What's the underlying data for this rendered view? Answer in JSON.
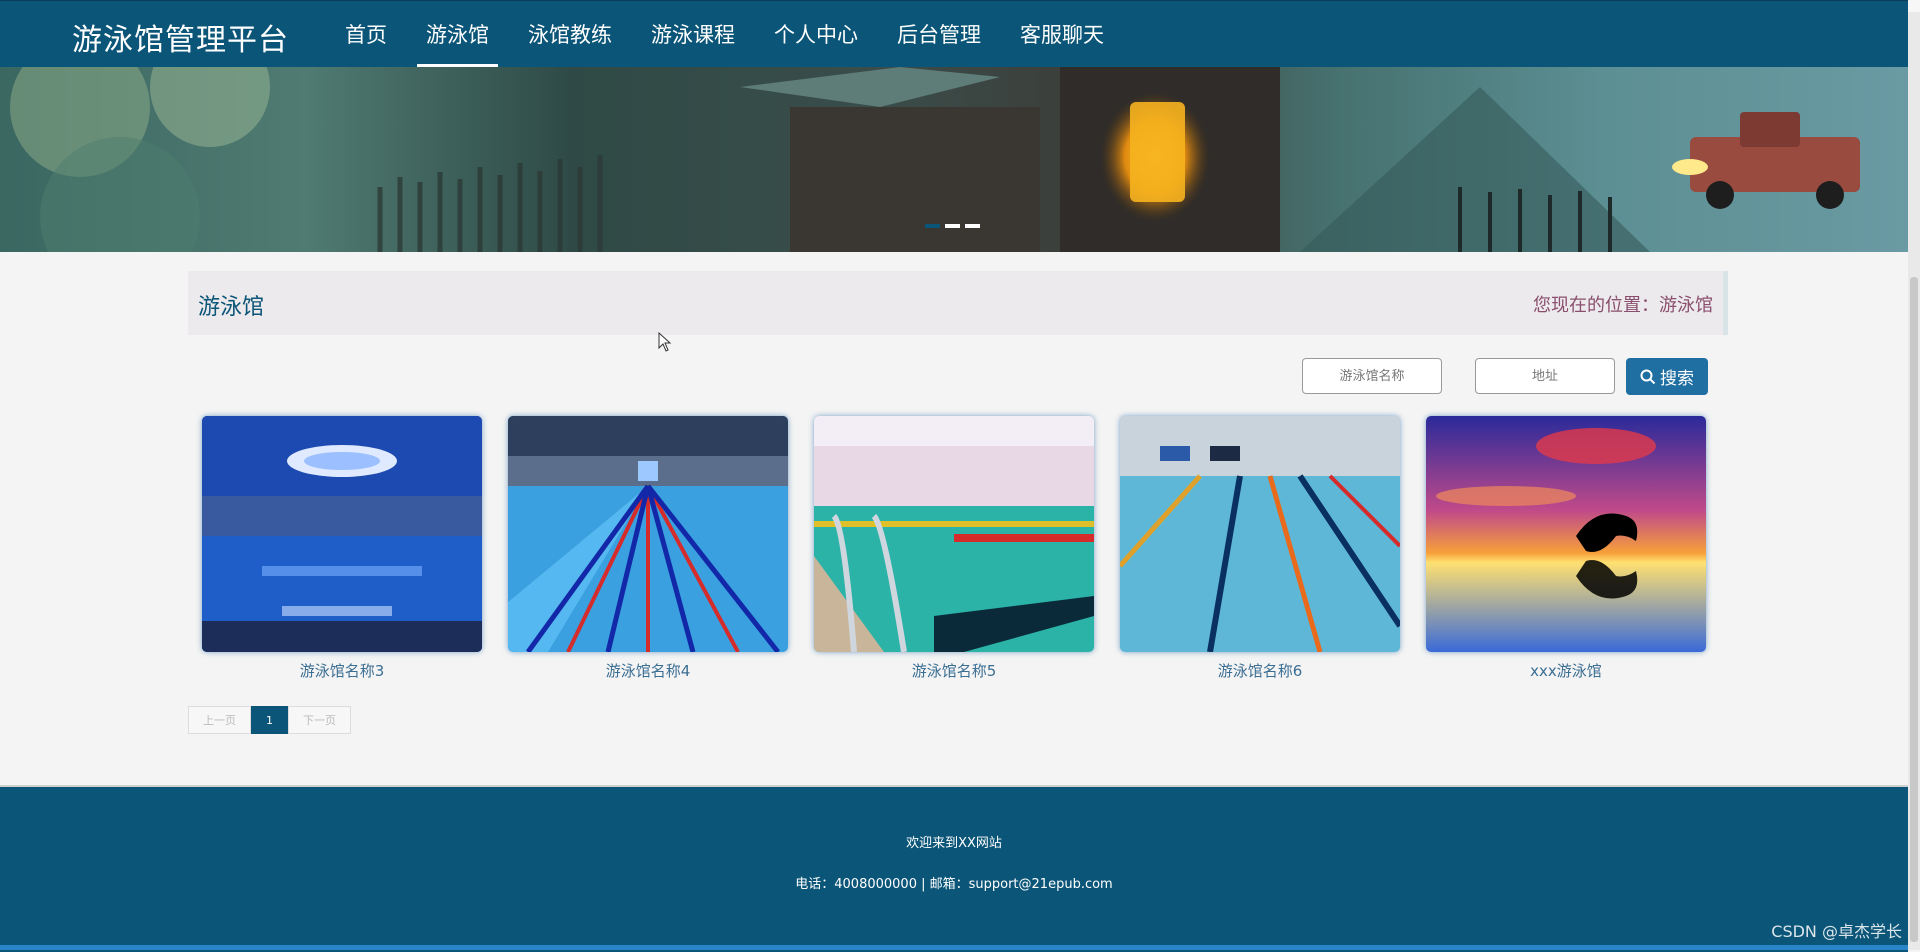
{
  "header": {
    "brand": "游泳馆管理平台",
    "nav": [
      "首页",
      "游泳馆",
      "泳馆教练",
      "游泳课程",
      "个人中心",
      "后台管理",
      "客服聊天"
    ],
    "active_nav": "游泳馆"
  },
  "banner": {
    "slides": 3,
    "active_slide": 1
  },
  "page": {
    "title": "游泳馆",
    "location": "您现在的位置：游泳馆"
  },
  "search": {
    "name_placeholder": "游泳馆名称",
    "address_placeholder": "地址",
    "button_label": "搜索",
    "button_icon": "search-icon"
  },
  "cards": [
    {
      "label": "游泳馆名称3"
    },
    {
      "label": "游泳馆名称4"
    },
    {
      "label": "游泳馆名称5"
    },
    {
      "label": "游泳馆名称6"
    },
    {
      "label": "xxx游泳馆"
    }
  ],
  "pagination": {
    "prev": "上一页",
    "current": "1",
    "next": "下一页"
  },
  "footer": {
    "welcome": "欢迎来到XX网站",
    "contact": "电话：4008000000 | 邮箱：support@21epub.com"
  },
  "watermark": "CSDN @卓杰学长",
  "colors": {
    "primary": "#0b5578",
    "button": "#1f6fa3"
  }
}
